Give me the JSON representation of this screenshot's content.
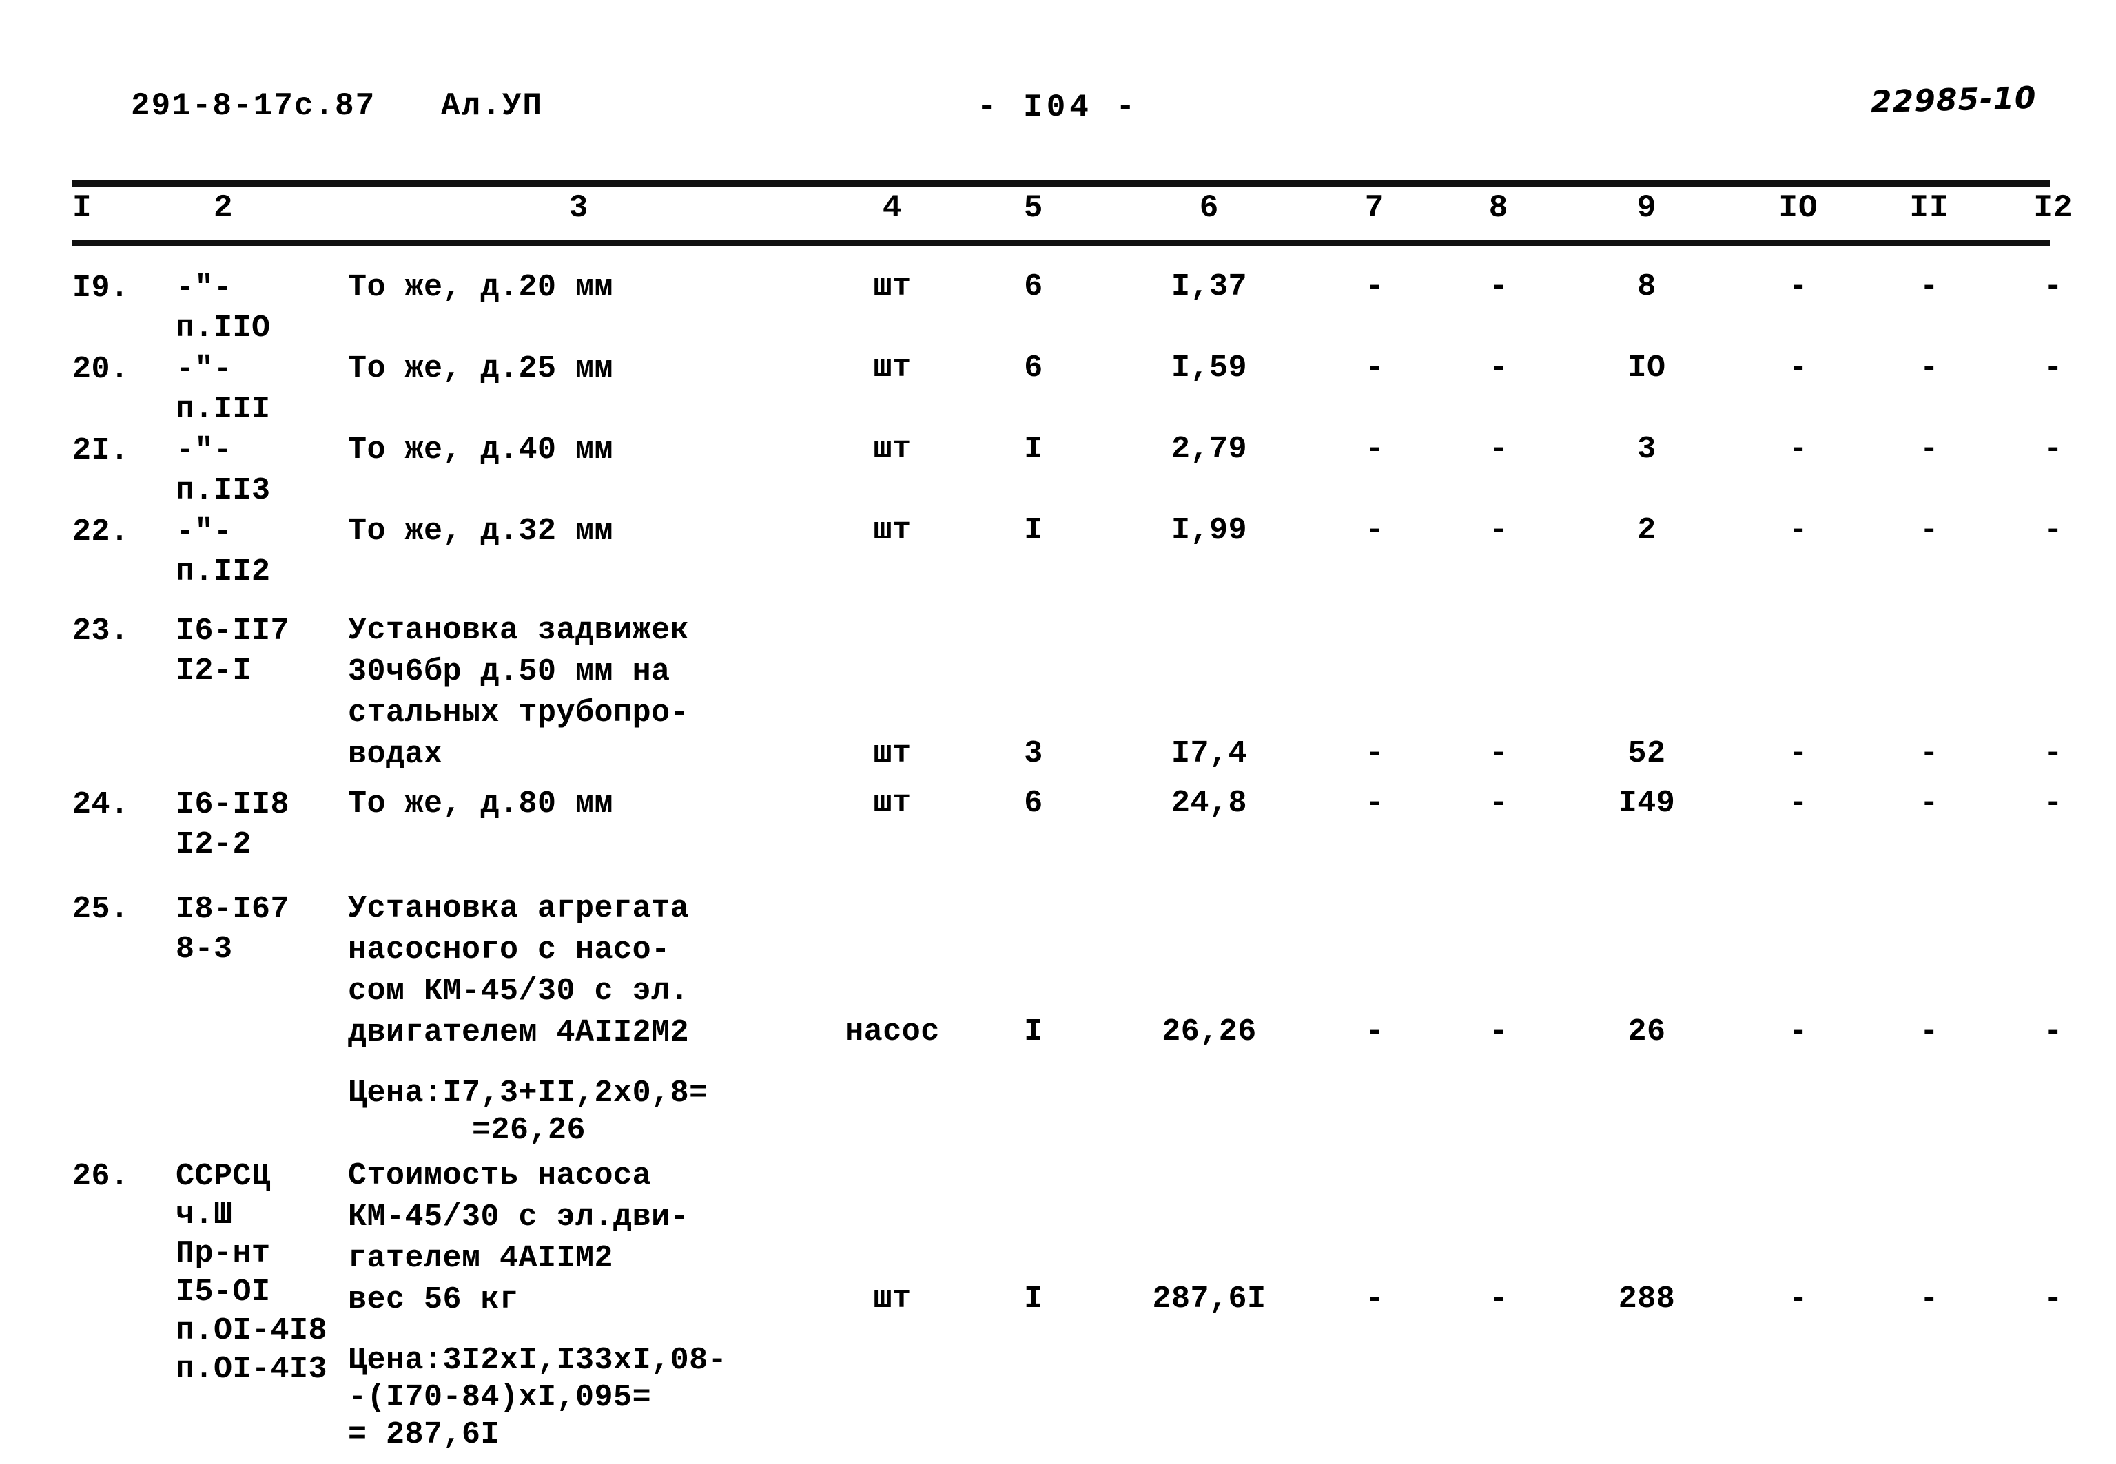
{
  "header": {
    "document_code": "291-8-17с.87",
    "album": "Ал.УП",
    "page_label": "- I04 -",
    "stamp": "22985-10"
  },
  "table": {
    "column_headers": [
      "I",
      "2",
      "3",
      "4",
      "5",
      "6",
      "7",
      "8",
      "9",
      "IO",
      "II",
      "I2"
    ],
    "rows": [
      {
        "num": "I9.",
        "code_line1": "-\"-",
        "code_line2": "п.IIO",
        "desc": "То же, д.20 мм",
        "unit": "шт",
        "qty": "6",
        "price": "I,37",
        "c7": "-",
        "c8": "-",
        "c9": "8",
        "c10": "-",
        "c11": "-",
        "c12": "-"
      },
      {
        "num": "20.",
        "code_line1": "-\"-",
        "code_line2": "п.III",
        "desc": "То же, д.25 мм",
        "unit": "шт",
        "qty": "6",
        "price": "I,59",
        "c7": "-",
        "c8": "-",
        "c9": "IO",
        "c10": "-",
        "c11": "-",
        "c12": "-"
      },
      {
        "num": "2I.",
        "code_line1": "-\"-",
        "code_line2": "п.II3",
        "desc": "То же, д.40 мм",
        "unit": "шт",
        "qty": "I",
        "price": "2,79",
        "c7": "-",
        "c8": "-",
        "c9": "3",
        "c10": "-",
        "c11": "-",
        "c12": "-"
      },
      {
        "num": "22.",
        "code_line1": "-\"-",
        "code_line2": "п.II2",
        "desc": "То же, д.32 мм",
        "unit": "шт",
        "qty": "I",
        "price": "I,99",
        "c7": "-",
        "c8": "-",
        "c9": "2",
        "c10": "-",
        "c11": "-",
        "c12": "-"
      },
      {
        "num": "23.",
        "code_line1": "I6-II7",
        "code_line2": "I2-I",
        "desc": "Установка задвижек\n30ч6бр д.50 мм на\nстальных трубопро-\nводах",
        "unit": "шт",
        "qty": "3",
        "price": "I7,4",
        "c7": "-",
        "c8": "-",
        "c9": "52",
        "c10": "-",
        "c11": "-",
        "c12": "-"
      },
      {
        "num": "24.",
        "code_line1": "I6-II8",
        "code_line2": "I2-2",
        "desc": "То же, д.80 мм",
        "unit": "шт",
        "qty": "6",
        "price": "24,8",
        "c7": "-",
        "c8": "-",
        "c9": "I49",
        "c10": "-",
        "c11": "-",
        "c12": "-"
      },
      {
        "num": "25.",
        "code_line1": "I8-I67",
        "code_line2": "8-3",
        "desc": "Установка агрегата\nнасосного с насо-\nсом КМ-45/30 с эл.\nдвигателем 4АII2М2",
        "note_line1": "Цена:I7,3+II,2х0,8=",
        "note_line2": "=26,26",
        "unit": "насос",
        "qty": "I",
        "price": "26,26",
        "c7": "-",
        "c8": "-",
        "c9": "26",
        "c10": "-",
        "c11": "-",
        "c12": "-"
      },
      {
        "num": "26.",
        "code_line1": "ССРСЦ",
        "code_line2": "ч.Ш",
        "code_line3": "Пр-нт",
        "code_line4": "I5-OI",
        "code_line5": "п.OI-4I8",
        "code_line6": "п.OI-4I3",
        "desc": "Стоимость насоса\nКМ-45/30 с эл.дви-\nгателем 4АIIМ2\nвес 56 кг",
        "note_line1": "Цена:3I2хI,I33хI,08-",
        "note_line2": "-(I70-84)хI,095=",
        "note_line3": "= 287,6I",
        "unit": "шт",
        "qty": "I",
        "price": "287,6I",
        "c7": "-",
        "c8": "-",
        "c9": "288",
        "c10": "-",
        "c11": "-",
        "c12": "-"
      }
    ]
  }
}
